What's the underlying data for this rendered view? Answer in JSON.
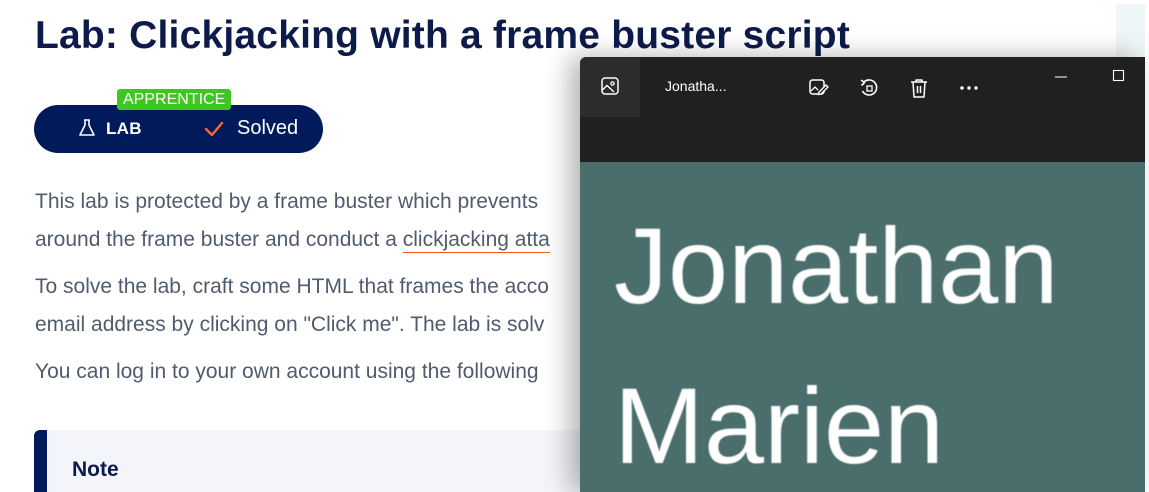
{
  "lab": {
    "title": "Lab: Clickjacking with a frame buster script",
    "level": "APPRENTICE",
    "badge_label": "LAB",
    "status": "Solved",
    "paragraphs": [
      {
        "before": "This lab is protected by a frame buster which prevents",
        "line2_before": "around the frame buster and conduct a ",
        "link": "clickjacking atta"
      },
      {
        "line1": "To solve the lab, craft some HTML that frames the acco",
        "line2": "email address by clicking on \"Click me\". The lab is solv"
      },
      {
        "line1": "You can log in to your own account using the following"
      }
    ],
    "note_title": "Note"
  },
  "viewer": {
    "title": "Jonatha...",
    "toolbar_icons": [
      "gallery-icon",
      "edit-image-icon",
      "rotate-icon",
      "delete-icon",
      "more-icon"
    ],
    "window_controls": [
      "minimize-icon",
      "maximize-icon"
    ],
    "photo_text_lines": [
      "Jonathan",
      "Marien"
    ]
  },
  "colors": {
    "title": "#0d1b4a",
    "pill": "#001a5c",
    "apprentice": "#3fc721",
    "check": "#ff6633",
    "link_underline": "#e85a1c",
    "viewer_bg": "#202020",
    "photo_bg": "#4a6e6c"
  }
}
